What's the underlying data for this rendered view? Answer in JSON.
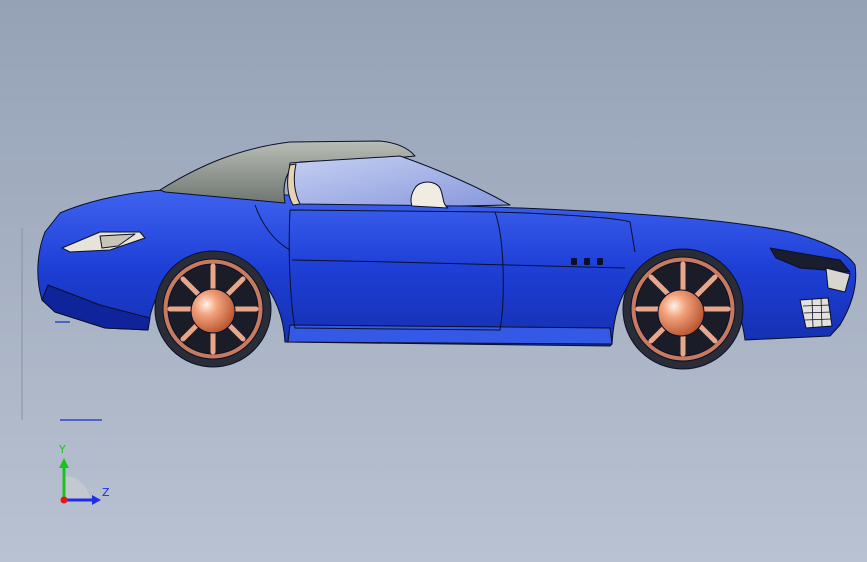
{
  "viewport": {
    "background_top": "#95a2b6",
    "background_bottom": "#b9c2d2"
  },
  "model": {
    "body_color": "#1e3fd6",
    "body_dark": "#0f249a",
    "roof_color": "#8e9690",
    "glass_color": "#9fb0e6",
    "rim_color": "#d98a6e",
    "hub_color": "#f08a5a",
    "tire_color": "#2a2c38",
    "outline_color": "#0a0f2a"
  },
  "triad": {
    "y_label": "Y",
    "z_label": "Z",
    "y_color": "#1ec21e",
    "z_color": "#1e2ee6",
    "x_color": "#e01818"
  }
}
